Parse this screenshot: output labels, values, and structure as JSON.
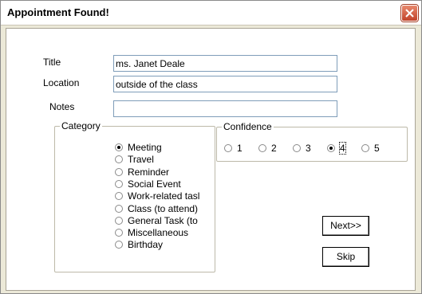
{
  "window": {
    "title": "Appointment Found!"
  },
  "fields": {
    "title_label": "Title",
    "title_value": "ms. Janet Deale",
    "location_label": "Location",
    "location_value": "outside of the class",
    "notes_label": "Notes",
    "notes_value": ""
  },
  "category": {
    "label": "Category",
    "options": [
      {
        "label": "Meeting",
        "checked": true
      },
      {
        "label": "Travel",
        "checked": false
      },
      {
        "label": "Reminder",
        "checked": false
      },
      {
        "label": "Social Event",
        "checked": false
      },
      {
        "label": "Work-related tasl",
        "checked": false
      },
      {
        "label": "Class (to attend)",
        "checked": false
      },
      {
        "label": "General Task (to",
        "checked": false
      },
      {
        "label": "Miscellaneous",
        "checked": false
      },
      {
        "label": "Birthday",
        "checked": false
      }
    ]
  },
  "confidence": {
    "label": "Confidence",
    "options": [
      {
        "label": "1",
        "checked": false
      },
      {
        "label": "2",
        "checked": false
      },
      {
        "label": "3",
        "checked": false
      },
      {
        "label": "4",
        "checked": true
      },
      {
        "label": "5",
        "checked": false
      }
    ]
  },
  "buttons": {
    "next_label": "Next>>",
    "skip_label": "Skip"
  }
}
